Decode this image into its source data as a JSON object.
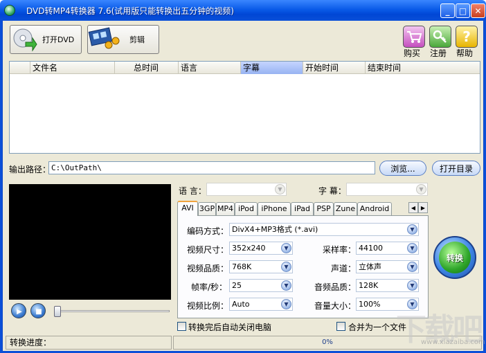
{
  "window": {
    "title": "DVD转MP4转换器 7.6(试用版只能转换出五分钟的视频)",
    "minimize": "_",
    "maximize": "□",
    "close": "✕"
  },
  "toolbar": {
    "open_dvd": "打开DVD",
    "edit": "剪辑",
    "buy": "购买",
    "register": "注册",
    "help": "帮助"
  },
  "file_list": {
    "columns": [
      "文件名",
      "总时间",
      "语言",
      "字幕",
      "开始时间",
      "结束时间"
    ],
    "active_column": "字幕",
    "rows": []
  },
  "output": {
    "label": "输出路径：",
    "path": "C:\\OutPath\\",
    "browse": "浏览...",
    "open_dir": "打开目录"
  },
  "player": {
    "play_icon": "play-icon",
    "stop_icon": "stop-icon",
    "position": 0
  },
  "tracks": {
    "language_label": "语 言：",
    "subtitle_label": "字 幕：",
    "language_value": "",
    "subtitle_value": ""
  },
  "format_tabs": [
    "AVI",
    "3GP",
    "MP4",
    "iPod",
    "iPhone",
    "iPad",
    "PSP",
    "Zune",
    "Android"
  ],
  "active_tab": "AVI",
  "settings": {
    "codec_label": "编码方式：",
    "codec_value": "DivX4+MP3格式 (*.avi)",
    "video_size_label": "视频尺寸：",
    "video_size_value": "352x240",
    "sample_rate_label": "采样率：",
    "sample_rate_value": "44100",
    "video_quality_label": "视频品质：",
    "video_quality_value": "768K",
    "channel_label": "声道：",
    "channel_value": "立体声",
    "frame_rate_label": "帧率/秒：",
    "frame_rate_value": "25",
    "audio_quality_label": "音频品质：",
    "audio_quality_value": "128K",
    "aspect_label": "视频比例：",
    "aspect_value": "Auto",
    "volume_label": "音量大小：",
    "volume_value": "100%"
  },
  "convert": {
    "label": "转换"
  },
  "options": {
    "shutdown_label": "转换完后自动关闭电脑",
    "shutdown_checked": false,
    "merge_label": "合并为一个文件",
    "merge_checked": false
  },
  "status": {
    "progress_label": "转换进度：",
    "progress_value": 0,
    "progress_text": "0%"
  },
  "watermark": {
    "text": "下载吧",
    "sub": "www.xiazaiba.com"
  },
  "colors": {
    "titlebar": "#0a5be8",
    "window_bg": "#ece9d8",
    "tab_accent": "#f1a33c"
  }
}
